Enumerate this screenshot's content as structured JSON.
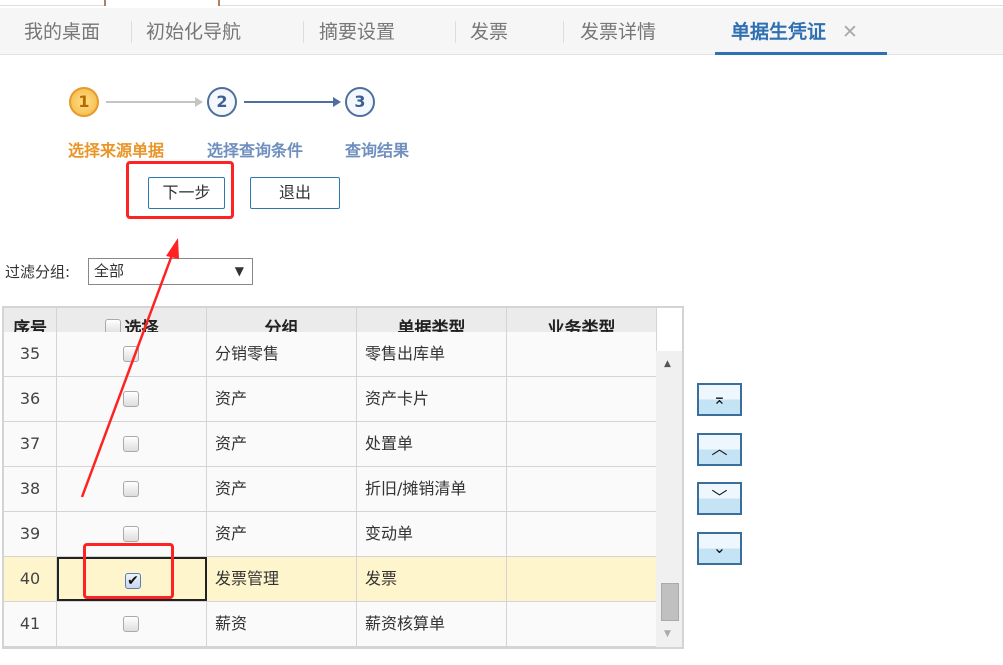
{
  "tabs": [
    {
      "label": "我的桌面"
    },
    {
      "label": "初始化导航"
    },
    {
      "label": "摘要设置"
    },
    {
      "label": "发票"
    },
    {
      "label": "发票详情"
    },
    {
      "label": "单据生凭证",
      "active": true,
      "close": "✕"
    }
  ],
  "steps": [
    {
      "num": "1",
      "label": "选择来源单据"
    },
    {
      "num": "2",
      "label": "选择查询条件"
    },
    {
      "num": "3",
      "label": "查询结果"
    }
  ],
  "buttons": {
    "next": "下一步",
    "exit": "退出"
  },
  "filter": {
    "label": "过滤分组:",
    "value": "全部"
  },
  "table": {
    "headers": [
      "序号",
      "选择",
      "分组",
      "单据类型",
      "业务类型"
    ],
    "rows": [
      {
        "no": "35",
        "checked": false,
        "group": "分销零售",
        "type": "零售出库单",
        "biz": ""
      },
      {
        "no": "36",
        "checked": false,
        "group": "资产",
        "type": "资产卡片",
        "biz": ""
      },
      {
        "no": "37",
        "checked": false,
        "group": "资产",
        "type": "处置单",
        "biz": ""
      },
      {
        "no": "38",
        "checked": false,
        "group": "资产",
        "type": "折旧/摊销清单",
        "biz": ""
      },
      {
        "no": "39",
        "checked": false,
        "group": "资产",
        "type": "变动单",
        "biz": ""
      },
      {
        "no": "40",
        "checked": true,
        "group": "发票管理",
        "type": "发票",
        "biz": ""
      },
      {
        "no": "41",
        "checked": false,
        "group": "薪资",
        "type": "薪资核算单",
        "biz": ""
      }
    ]
  },
  "side_buttons": [
    {
      "icon": "move-top-icon",
      "glyph": "⌅"
    },
    {
      "icon": "move-up-icon",
      "glyph": "︿"
    },
    {
      "icon": "move-down-icon",
      "glyph": "﹀"
    },
    {
      "icon": "move-bottom-icon",
      "glyph": "⌄"
    }
  ],
  "colors": {
    "accent": "#2f6fb3",
    "step_active": "#e8962a",
    "step_inactive": "#6f8fbf",
    "annotation": "#ff2222"
  }
}
